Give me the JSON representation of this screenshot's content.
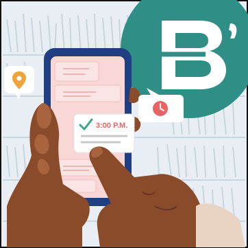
{
  "illustration": {
    "logo_text": "B’",
    "notification": {
      "time_label": "3:00 P.M."
    }
  },
  "colors": {
    "background": "#e8eef3",
    "shelf_line": "#c9d6df",
    "teal": "#2f8f86",
    "phone_body": "#1f3f82",
    "screen": "#f9d7d6",
    "card": "#ffffff",
    "accent_red": "#e86464",
    "check_green": "#3aa789",
    "pin_orange": "#f0a23c",
    "skin_dark": "#8a4b2b",
    "skin_light": "#a8633f",
    "sleeve": "#e9d3c3"
  },
  "icons": [
    "location-pin-icon",
    "clock-icon",
    "checkmark-icon"
  ]
}
